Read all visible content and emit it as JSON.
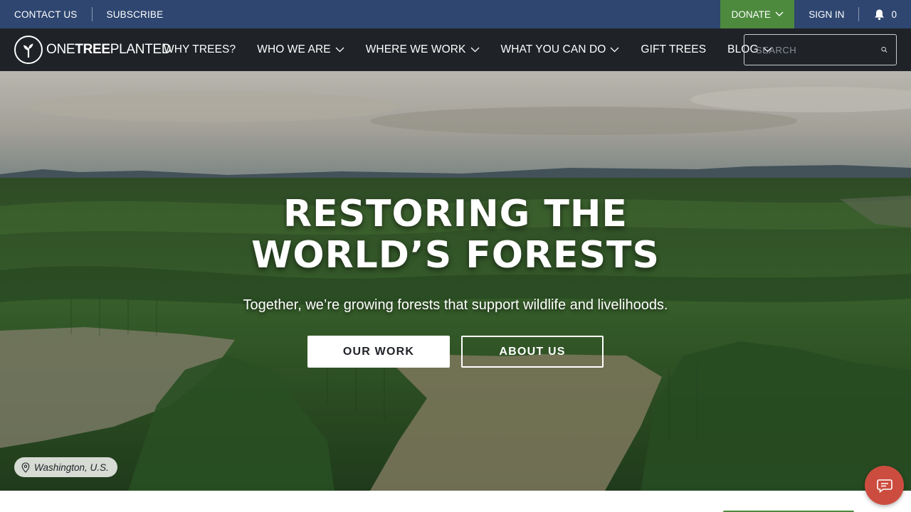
{
  "utility_bar": {
    "contact_label": "CONTACT US",
    "subscribe_label": "SUBSCRIBE",
    "donate_label": "DONATE",
    "signin_label": "SIGN IN",
    "notification_count": "0"
  },
  "brand": {
    "logo_one": "ONE",
    "logo_tree": "TREE",
    "logo_planted": "PLANTED"
  },
  "nav": {
    "items": [
      {
        "label": "WHY TREES?"
      },
      {
        "label": "WHO WE ARE"
      },
      {
        "label": "WHERE WE WORK"
      },
      {
        "label": "WHAT YOU CAN DO"
      },
      {
        "label": "GIFT TREES"
      },
      {
        "label": "BLOG"
      }
    ],
    "search_placeholder": "SEARCH"
  },
  "hero": {
    "title_line1": "RESTORING THE",
    "title_line2": "WORLD’S FORESTS",
    "subtitle": "Together, we’re growing forests that support wildlife and livelihoods.",
    "primary_button": "OUR WORK",
    "secondary_button": "ABOUT US",
    "location": "Washington, U.S."
  },
  "colors": {
    "utility_bar_bg": "#2e4670",
    "donate_bg": "#4d8a3e",
    "nav_bg": "#1f2227",
    "chat_bg": "#cc4d3f"
  }
}
